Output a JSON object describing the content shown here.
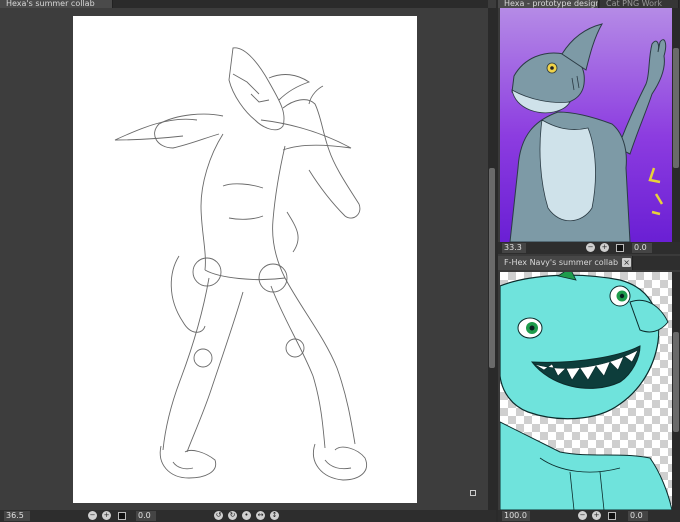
{
  "left_tab": {
    "title": "Hexa's summer collab"
  },
  "top_right_tabs": [
    {
      "title": "Hexa - prototype design"
    },
    {
      "title": "Cat PNG Work"
    }
  ],
  "bottom_right_tab": {
    "title": "F-Hex Navy's summer collab",
    "close": "×"
  },
  "status": {
    "left_zoom": "36.5",
    "left_angle": "0.0",
    "top_right_zoom": "33.3",
    "top_right_angle": "0.0",
    "bottom_right_zoom": "100.0",
    "bottom_right_angle": "0.0"
  },
  "colors": {
    "purple_top": "#b58be6",
    "purple_bottom": "#6a1fd4",
    "shark_grey": "#7d9aa6",
    "shark_teal": "#6fe3dc"
  }
}
